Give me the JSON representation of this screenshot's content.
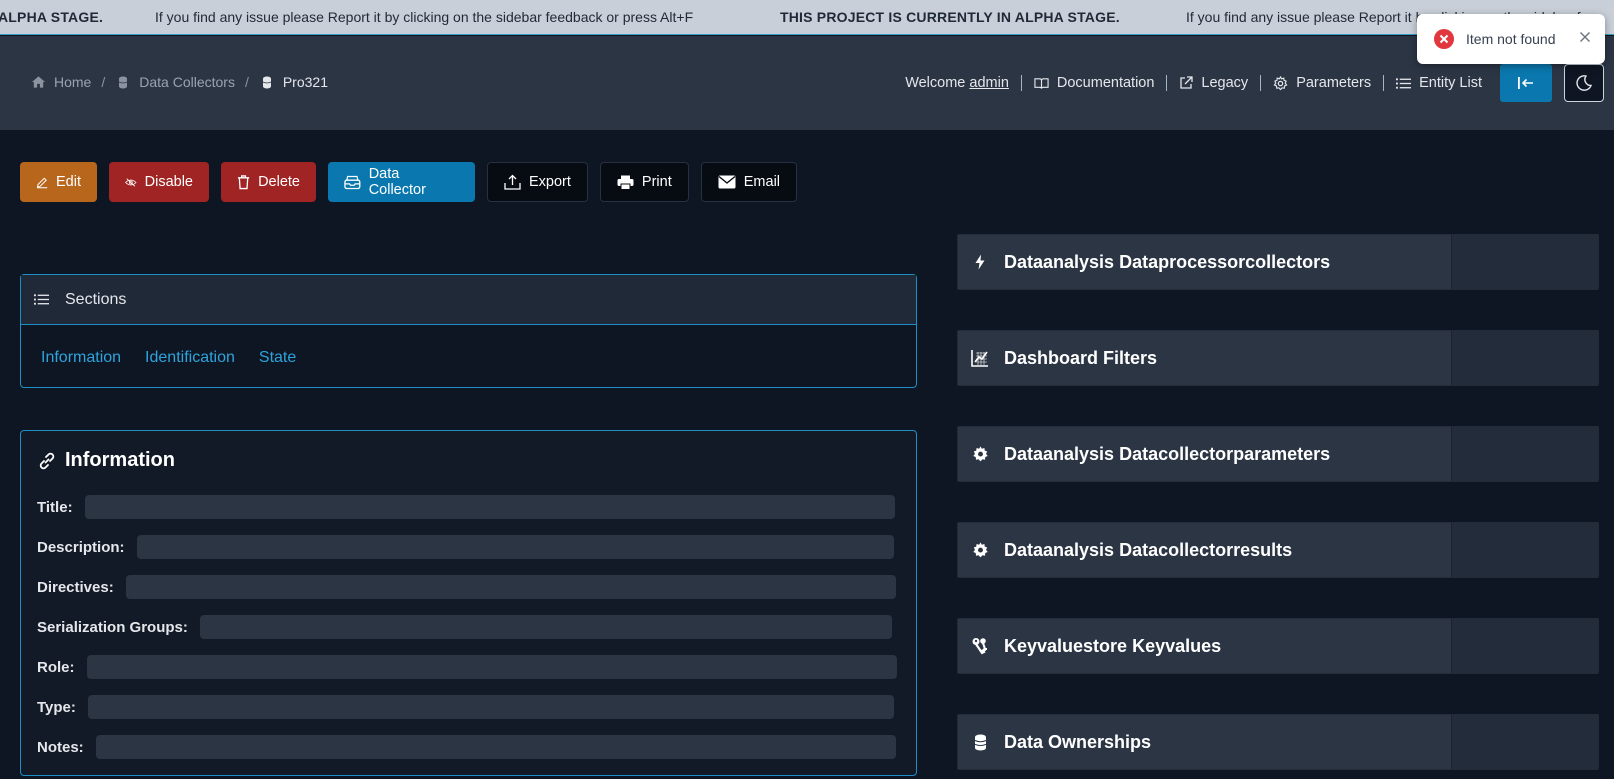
{
  "banner": {
    "alpha_left": "ALPHA STAGE.",
    "message_1": "If you find any issue please Report it by clicking on the sidebar feedback or press Alt+F",
    "alpha_full": "THIS PROJECT IS CURRENTLY IN ALPHA STAGE.",
    "message_2": "If you find any issue please Report it by clicking on the sidebar fe"
  },
  "breadcrumb": {
    "home": "Home",
    "collectors": "Data Collectors",
    "current": "Pro321"
  },
  "topnav": {
    "welcome": "Welcome",
    "user": "admin",
    "documentation": "Documentation",
    "legacy": "Legacy",
    "parameters": "Parameters",
    "entity_list": "Entity List"
  },
  "toast": {
    "message": "Item not found"
  },
  "actions": {
    "edit": "Edit",
    "disable": "Disable",
    "delete": "Delete",
    "data_collector": "Data Collector",
    "export": "Export",
    "print": "Print",
    "email": "Email"
  },
  "sections": {
    "title": "Sections",
    "links": [
      "Information",
      "Identification",
      "State"
    ]
  },
  "information": {
    "title": "Information",
    "fields": [
      "Title:",
      "Description:",
      "Directives:",
      "Serialization Groups:",
      "Role:",
      "Type:",
      "Notes:"
    ]
  },
  "panels": [
    {
      "label": "Dataanalysis Dataprocessorcollectors",
      "icon": "bolt-icon"
    },
    {
      "label": "Dashboard Filters",
      "icon": "chart-grid-icon"
    },
    {
      "label": "Dataanalysis Datacollectorparameters",
      "icon": "gear-icon"
    },
    {
      "label": "Dataanalysis Datacollectorresults",
      "icon": "gear-icon"
    },
    {
      "label": "Keyvaluestore Keyvalues",
      "icon": "keys-icon"
    },
    {
      "label": "Data Ownerships",
      "icon": "database-icon"
    }
  ],
  "colors": {
    "accent": "#0a78ae",
    "edit": "#b8661c",
    "danger": "#a02424",
    "link": "#2ea3dc"
  }
}
